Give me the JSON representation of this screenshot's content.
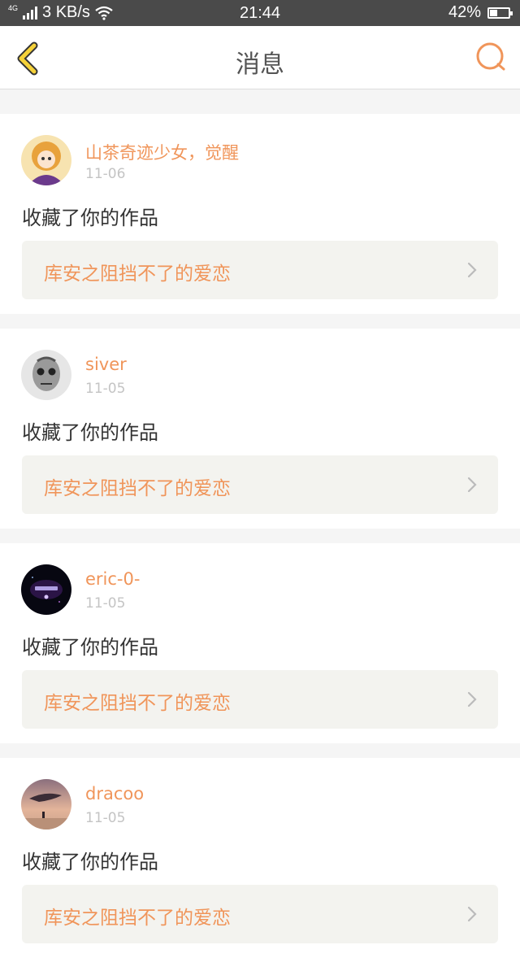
{
  "status_bar": {
    "network_type": "4G",
    "speed": "3 KB/s",
    "time": "21:44",
    "battery_percent": "42%",
    "battery_level": 0.42
  },
  "header": {
    "title": "消息",
    "back_icon": "chevron-left-icon",
    "right_icon": "chat-bubble-icon"
  },
  "colors": {
    "accent": "#f0955a",
    "back": "#f5d23a"
  },
  "messages": [
    {
      "user": "山茶奇迹少女，觉醒",
      "date": "11-06",
      "action": "收藏了你的作品",
      "work_title": "库安之阻挡不了的爱恋"
    },
    {
      "user": "siver",
      "date": "11-05",
      "action": "收藏了你的作品",
      "work_title": "库安之阻挡不了的爱恋"
    },
    {
      "user": "eric-0-",
      "date": "11-05",
      "action": "收藏了你的作品",
      "work_title": "库安之阻挡不了的爱恋"
    },
    {
      "user": "dracoo",
      "date": "11-05",
      "action": "收藏了你的作品",
      "work_title": "库安之阻挡不了的爱恋"
    }
  ]
}
